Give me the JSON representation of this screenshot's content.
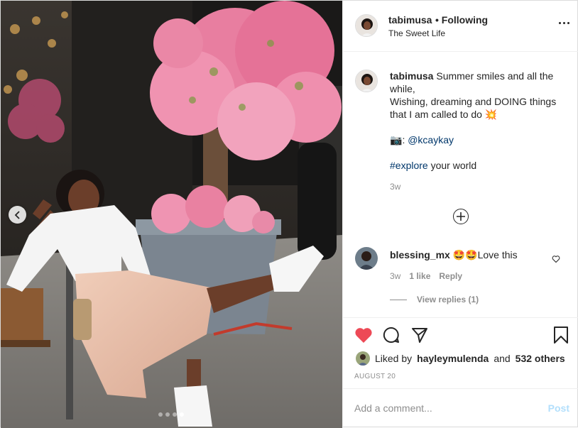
{
  "post": {
    "username": "tabimusa",
    "follow_status": "• Following",
    "location": "The Sweet Life",
    "photo_alt": "Woman in white top and blush skirt seated beside a pink blossom planter",
    "carousel": {
      "dots": 4,
      "active_index": 3
    }
  },
  "caption": {
    "username": "tabimusa",
    "line1": "Summer smiles and all the while,",
    "line2": "Wishing, dreaming and DOING things that I am called to do",
    "line2_emoji": "💥",
    "credit_emoji": "📷",
    "credit_handle": "@kcaykay",
    "hashtag": "#explore",
    "hashtag_rest": "your world",
    "time": "3w"
  },
  "comments": [
    {
      "username": "blessing_mx",
      "emoji": "🤩🤩",
      "text": "Love this",
      "time": "3w",
      "likes": "1 like",
      "reply_label": "Reply",
      "view_replies": "View replies (1)"
    }
  ],
  "engagement": {
    "liked_by_prefix": "Liked by",
    "liked_by_user": "hayleymulenda",
    "and": "and",
    "others": "532 others",
    "date": "AUGUST 20",
    "like_color": "#ed4956"
  },
  "composer": {
    "placeholder": "Add a comment...",
    "post_label": "Post"
  }
}
